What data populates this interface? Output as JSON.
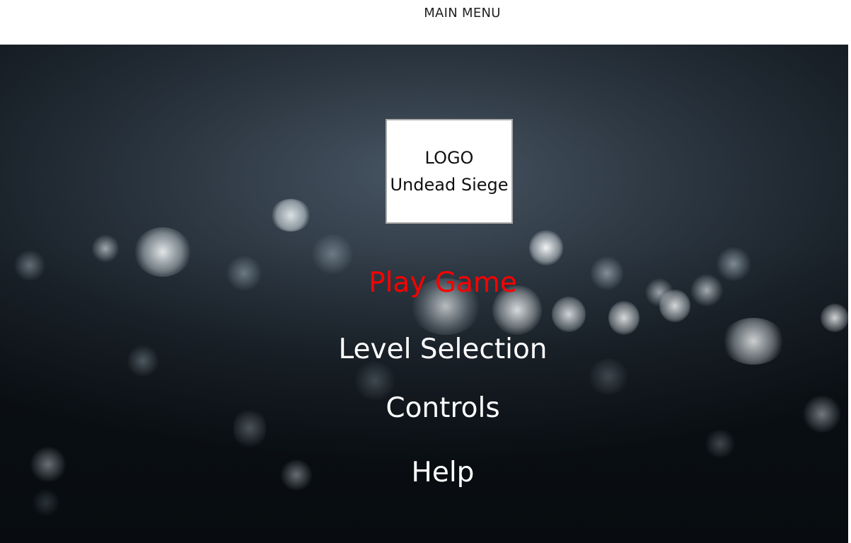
{
  "header": {
    "title": "MAIN MENU"
  },
  "logo": {
    "line1": "LOGO",
    "line2": "Undead Siege"
  },
  "menu": {
    "items": [
      {
        "label": "Play Game",
        "state": "highlighted"
      },
      {
        "label": "Level Selection",
        "state": "normal"
      },
      {
        "label": "Controls",
        "state": "normal"
      },
      {
        "label": "Help",
        "state": "normal"
      }
    ]
  },
  "colors": {
    "highlight": "#ff0000",
    "menu_text": "#ffffff",
    "background": "#1b232b"
  }
}
